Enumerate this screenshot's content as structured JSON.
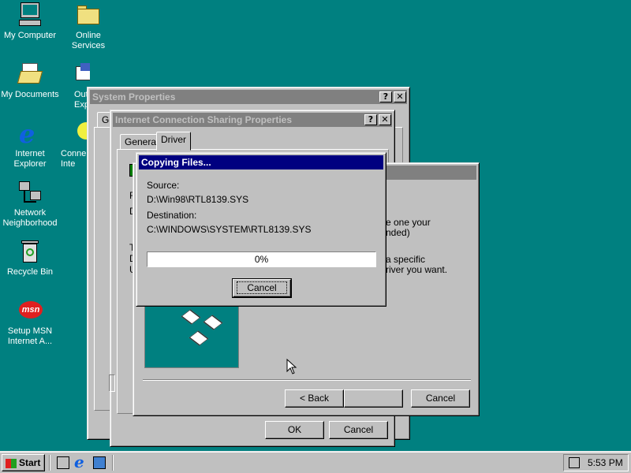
{
  "desktop": {
    "icons": [
      {
        "label": "My Computer"
      },
      {
        "label": "Online Services"
      },
      {
        "label": "My Documents"
      },
      {
        "label": "Outl Expr"
      },
      {
        "label": "Internet Explorer"
      },
      {
        "label": "Conne Inte"
      },
      {
        "label": "Network Neighborhood"
      },
      {
        "label": "Recycle Bin"
      },
      {
        "label": "Setup MSN Internet A..."
      }
    ],
    "msn_glyph": "msn"
  },
  "system_properties": {
    "title": "System Properties",
    "tab_partial": "Ge",
    "ok": "OK",
    "cancel": "Cancel"
  },
  "ics_properties": {
    "title": "Internet Connection Sharing Properties",
    "tabs": [
      "General",
      "Driver"
    ],
    "partial_letters": [
      "F",
      "D",
      "T",
      "D",
      "U"
    ]
  },
  "wizard": {
    "text_fragments": [
      "e one your",
      "nded)",
      "a specific",
      "river you want."
    ],
    "back": "< Back",
    "back_hotkey": "B",
    "cancel": "Cancel"
  },
  "copying": {
    "title": "Copying Files...",
    "source_label": "Source:",
    "source_path": "D:\\Win98\\RTL8139.SYS",
    "dest_label": "Destination:",
    "dest_path": "C:\\WINDOWS\\SYSTEM\\RTL8139.SYS",
    "progress_text": "0%",
    "progress": 0,
    "cancel": "Cancel"
  },
  "titlebar_buttons": {
    "help": "?",
    "close": "✕"
  },
  "taskbar": {
    "start": "Start",
    "clock": "5:53 PM"
  }
}
